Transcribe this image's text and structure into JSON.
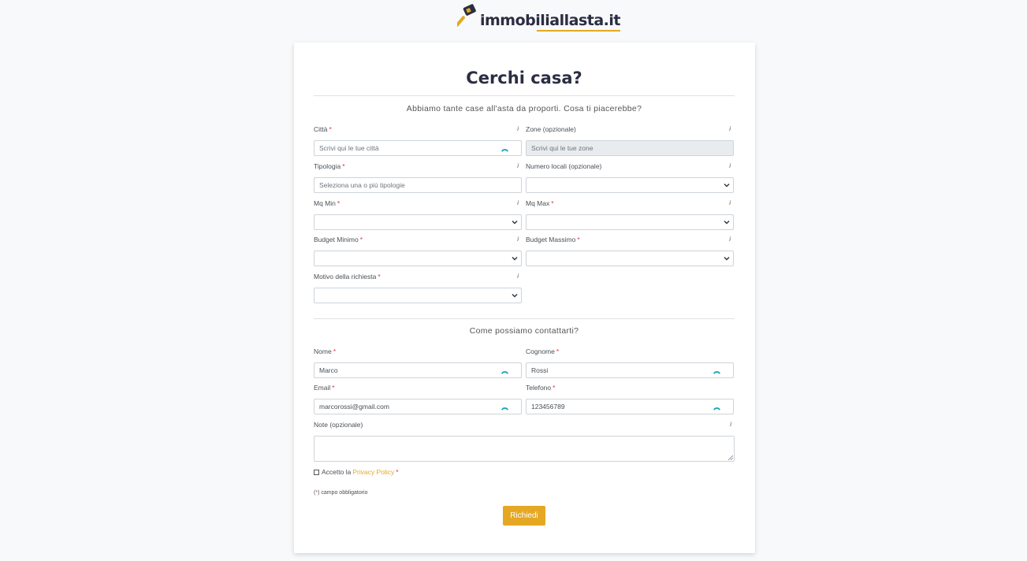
{
  "brand": {
    "name": "immobiliallasta.it",
    "accent": "#e5a823",
    "icon": "gavel-house-icon"
  },
  "form": {
    "title": "Cerchi casa?",
    "intro": "Abbiamo tante case all'asta da proporti. Cosa ti piacerebbe?",
    "info_glyph": "i",
    "required_mark": "*",
    "fields": {
      "citta": {
        "label": "Città",
        "placeholder": "Scrivi qui le tue città"
      },
      "zone": {
        "label": "Zone (opzionale)",
        "placeholder": "Scrivi qui le tue zone"
      },
      "tipologia": {
        "label": "Tipologia",
        "placeholder": "Seleziona una o più tipologie"
      },
      "numero_locali": {
        "label": "Numero locali (opzionale)",
        "value": ""
      },
      "mq_min": {
        "label": "Mq Min",
        "value": ""
      },
      "mq_max": {
        "label": "Mq Max",
        "value": ""
      },
      "budget_min": {
        "label": "Budget Minimo",
        "value": ""
      },
      "budget_max": {
        "label": "Budget Massimo",
        "value": ""
      },
      "motivo": {
        "label": "Motivo della richiesta",
        "value": ""
      }
    },
    "contact_heading": "Come possiamo contattarti?",
    "contact": {
      "nome": {
        "label": "Nome",
        "value": "Marco"
      },
      "cognome": {
        "label": "Cognome",
        "value": "Rossi"
      },
      "email": {
        "label": "Email",
        "value": "marcorossi@gmail.com"
      },
      "telefono": {
        "label": "Telefono",
        "value": "123456789"
      },
      "note": {
        "label": "Note (opzionale)",
        "value": ""
      }
    },
    "privacy": {
      "prefix": "Accetto la",
      "link": "Privacy Policy"
    },
    "required_note": {
      "open": "(",
      "mark": "*",
      "close": ") campo obbligatorio"
    },
    "submit_label": "Richiedi"
  }
}
